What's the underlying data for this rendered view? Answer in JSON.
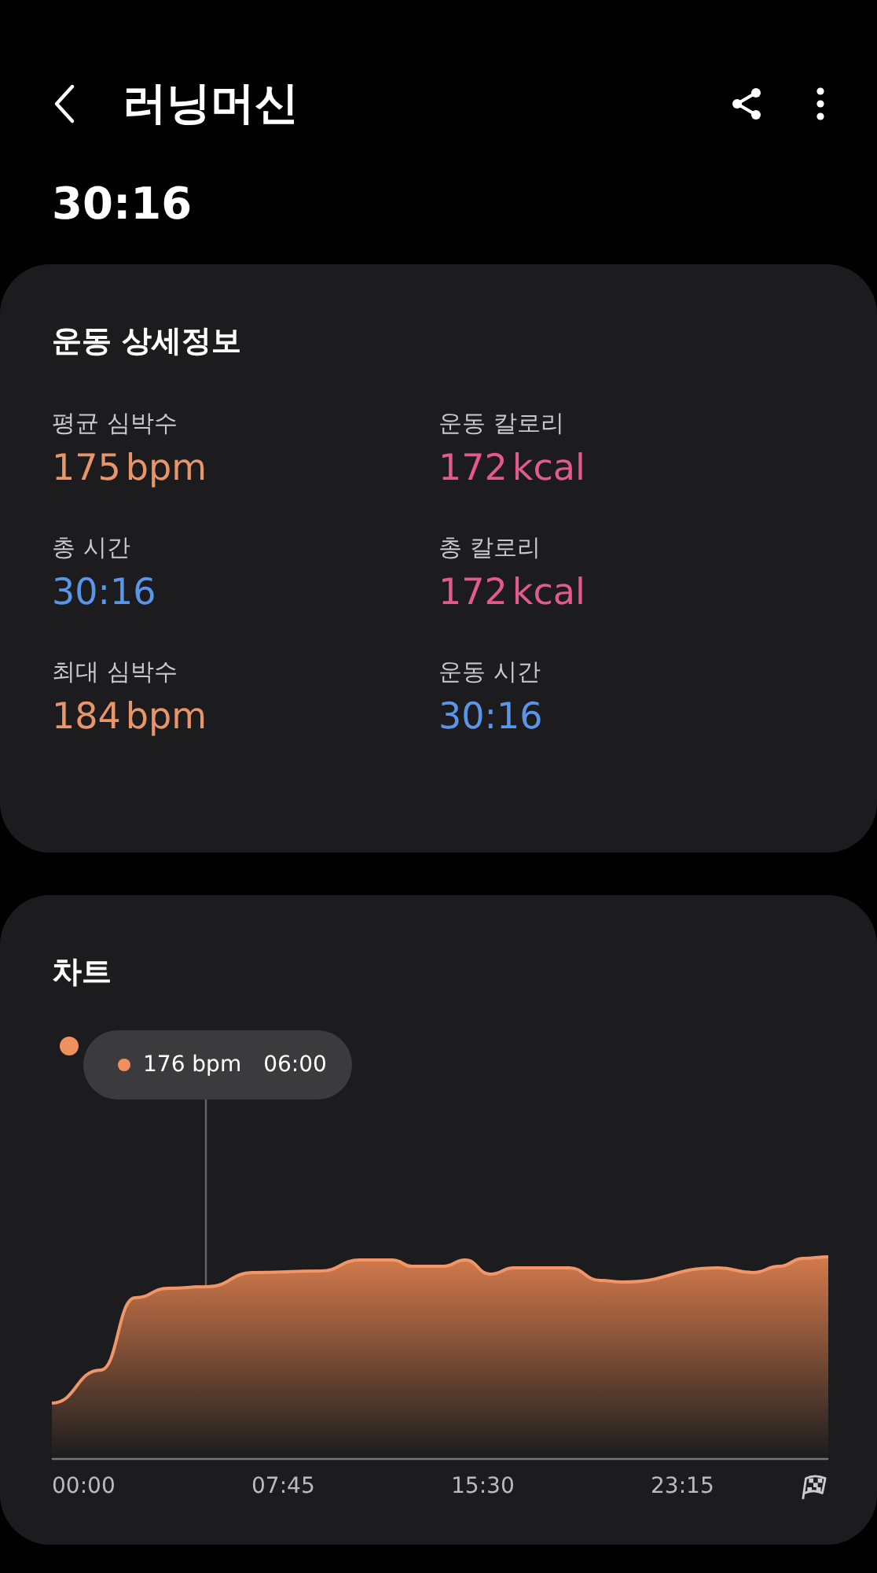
{
  "header": {
    "title": "러닝머신"
  },
  "duration": "30:16",
  "details": {
    "title": "운동 상세정보",
    "metrics": [
      {
        "label": "평균 심박수",
        "value": "175",
        "unit": "bpm",
        "color": "#e9956a"
      },
      {
        "label": "운동 칼로리",
        "value": "172",
        "unit": "kcal",
        "color": "#e45a8f"
      },
      {
        "label": "총 시간",
        "value": "30:16",
        "color": "#5b95ea"
      },
      {
        "label": "총 칼로리",
        "value": "172",
        "unit": "kcal",
        "color": "#e45a8f"
      },
      {
        "label": "최대 심박수",
        "value": "184",
        "unit": "bpm",
        "color": "#e9956a"
      },
      {
        "label": "운동 시간",
        "value": "30:16",
        "color": "#5b95ea"
      }
    ]
  },
  "chart": {
    "title": "차트",
    "tooltip": {
      "value": "176 bpm",
      "time": "06:00"
    },
    "x_labels": [
      "00:00",
      "07:45",
      "15:30",
      "23:15"
    ]
  }
}
